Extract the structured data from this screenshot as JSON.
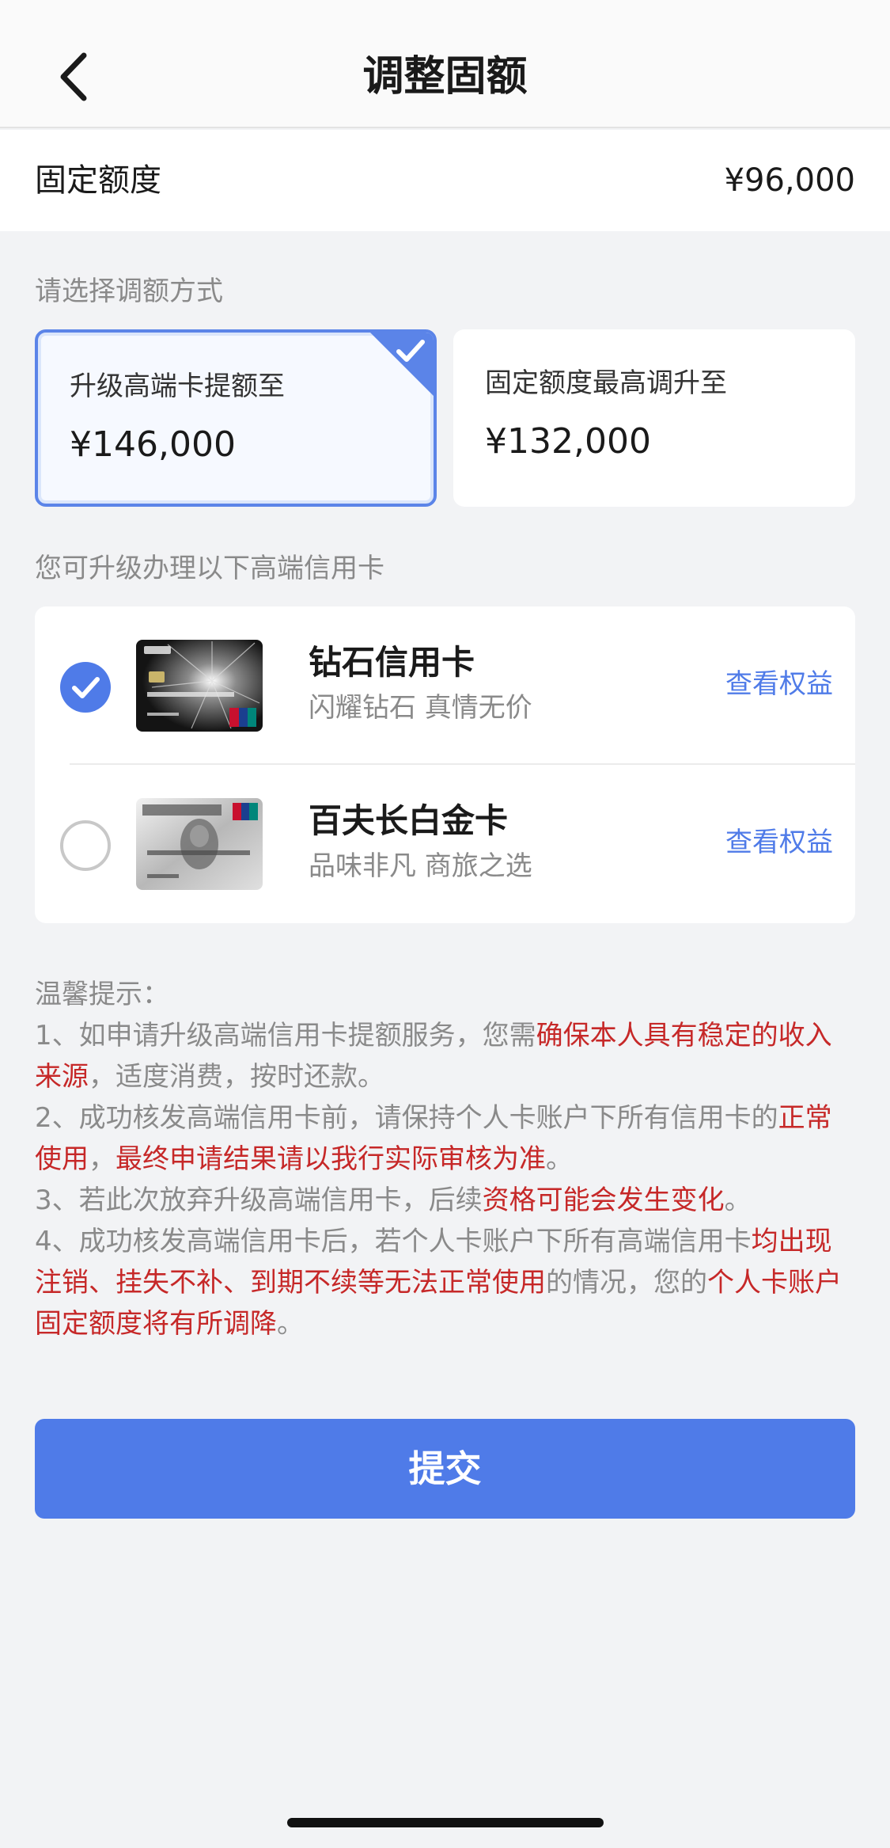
{
  "header": {
    "title": "调整固额",
    "back_icon": "chevron-left-icon"
  },
  "fixed_limit": {
    "label": "固定额度",
    "value": "¥96,000"
  },
  "adjust_section": {
    "label": "请选择调额方式",
    "options": [
      {
        "title": "升级高端卡提额至",
        "value": "¥146,000",
        "selected": true
      },
      {
        "title": "固定额度最高调升至",
        "value": "¥132,000",
        "selected": false
      }
    ]
  },
  "cards_section": {
    "label": "您可升级办理以下高端信用卡",
    "cards": [
      {
        "name": "钻石信用卡",
        "desc": "闪耀钻石 真情无价",
        "link": "查看权益",
        "selected": true
      },
      {
        "name": "百夫长白金卡",
        "desc": "品味非凡 商旅之选",
        "link": "查看权益",
        "selected": false
      }
    ]
  },
  "tips": {
    "title": "温馨提示：",
    "t1": {
      "a": "1、如申请升级高端信用卡提额服务，您需",
      "b": "确保本人具有稳定的收入来源",
      "c": "，适度消费，按时还款。"
    },
    "t2": {
      "a": "2、成功核发高端信用卡前，请保持个人卡账户下所有信用卡的",
      "b": "正常使用",
      "c": "，",
      "d": "最终申请结果请以我行实际审核为准",
      "e": "。"
    },
    "t3": {
      "a": "3、若此次放弃升级高端信用卡，后续",
      "b": "资格可能会发生变化",
      "c": "。"
    },
    "t4": {
      "a": "4、成功核发高端信用卡后，若个人卡账户下所有高端信用卡",
      "b": "均出现注销、挂失不补、到期不续等无法正常使用",
      "c": "的情况，您的",
      "d": "个人卡账户固定额度将有所调降",
      "e": "。"
    }
  },
  "submit": {
    "label": "提交"
  },
  "colors": {
    "accent": "#4f7be8",
    "warning_red": "#c62828",
    "muted": "#8a8a8a"
  }
}
